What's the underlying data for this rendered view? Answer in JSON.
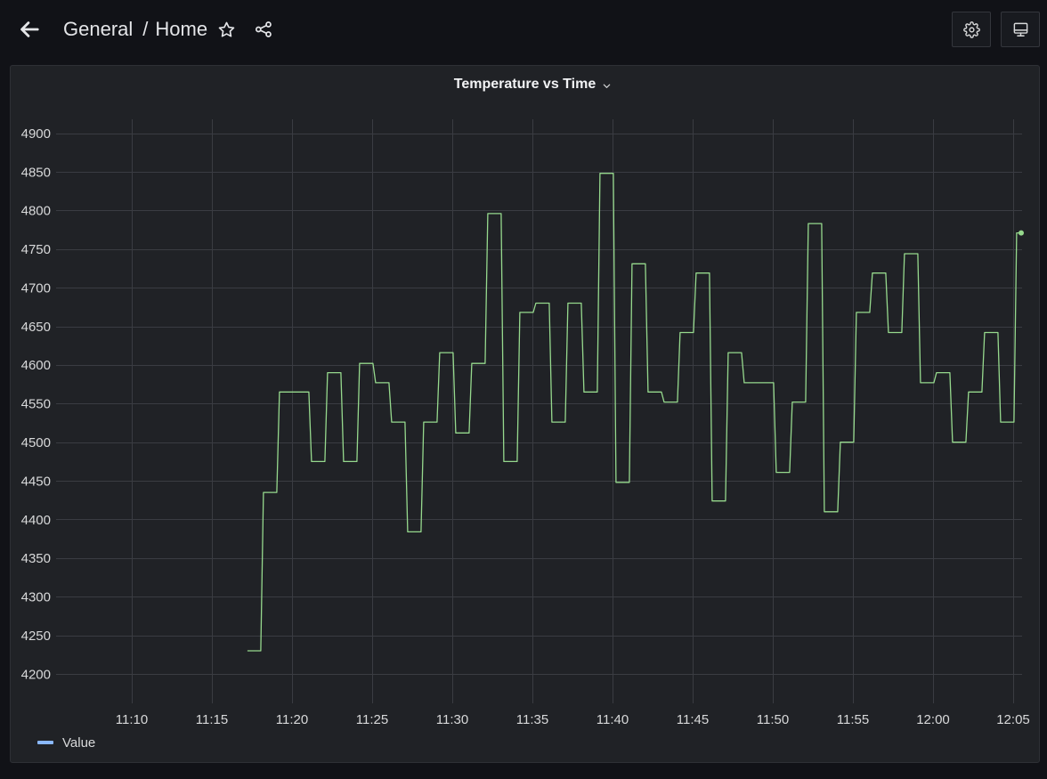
{
  "header": {
    "back_icon": "arrow-left-icon",
    "breadcrumb": {
      "folder": "General",
      "separator": "/",
      "dashboard": "Home"
    },
    "star_icon": "star-icon",
    "share_icon": "share-icon",
    "settings_icon": "gear-icon",
    "view_mode_icon": "monitor-icon"
  },
  "panel": {
    "menu_icon": "chevron-down-icon",
    "legend_swatch_color": "#8ab8ff"
  },
  "colors": {
    "page_background": "#111217",
    "panel_background": "#202226"
  },
  "chart_data": {
    "type": "line",
    "title": "Temperature vs Time",
    "x": [
      "11:17:13",
      "11:18:03",
      "11:18:13",
      "11:19:03",
      "11:19:13",
      "11:21:03",
      "11:21:13",
      "11:22:03",
      "11:22:13",
      "11:23:03",
      "11:23:13",
      "11:24:03",
      "11:24:13",
      "11:25:03",
      "11:25:13",
      "11:26:03",
      "11:26:13",
      "11:27:03",
      "11:27:13",
      "11:28:03",
      "11:28:13",
      "11:29:03",
      "11:29:13",
      "11:30:03",
      "11:30:13",
      "11:31:03",
      "11:31:13",
      "11:32:03",
      "11:32:13",
      "11:33:03",
      "11:33:13",
      "11:34:03",
      "11:34:13",
      "11:35:03",
      "11:35:13",
      "11:36:03",
      "11:36:13",
      "11:37:03",
      "11:37:13",
      "11:38:03",
      "11:38:13",
      "11:39:03",
      "11:39:13",
      "11:40:03",
      "11:40:13",
      "11:41:03",
      "11:41:13",
      "11:42:03",
      "11:42:13",
      "11:43:03",
      "11:43:13",
      "11:44:03",
      "11:44:13",
      "11:45:03",
      "11:45:13",
      "11:46:03",
      "11:46:13",
      "11:47:03",
      "11:47:13",
      "11:48:03",
      "11:48:13",
      "11:50:03",
      "11:50:13",
      "11:51:03",
      "11:51:13",
      "11:52:03",
      "11:52:13",
      "11:53:03",
      "11:53:13",
      "11:54:03",
      "11:54:13",
      "11:55:03",
      "11:55:13",
      "11:56:03",
      "11:56:13",
      "11:57:03",
      "11:57:13",
      "11:58:03",
      "11:58:13",
      "11:59:03",
      "11:59:13",
      "12:00:03",
      "12:00:13",
      "12:01:03",
      "12:01:13",
      "12:02:03",
      "12:02:13",
      "12:03:03",
      "12:03:13",
      "12:04:03",
      "12:04:13",
      "12:05:03",
      "12:05:13",
      "12:05:30"
    ],
    "series": [
      {
        "name": "Value",
        "color": "#96d98d",
        "values": [
          4230,
          4230,
          4435,
          4435,
          4565,
          4565,
          4475,
          4475,
          4590,
          4590,
          4475,
          4475,
          4602,
          4602,
          4577,
          4577,
          4526,
          4526,
          4384,
          4384,
          4526,
          4526,
          4616,
          4616,
          4512,
          4512,
          4602,
          4602,
          4796,
          4796,
          4475,
          4475,
          4668,
          4668,
          4680,
          4680,
          4526,
          4526,
          4680,
          4680,
          4565,
          4565,
          4848,
          4848,
          4448,
          4448,
          4731,
          4731,
          4565,
          4565,
          4552,
          4552,
          4642,
          4642,
          4719,
          4719,
          4424,
          4424,
          4616,
          4616,
          4577,
          4577,
          4461,
          4461,
          4552,
          4552,
          4783,
          4783,
          4410,
          4410,
          4500,
          4500,
          4668,
          4668,
          4719,
          4719,
          4642,
          4642,
          4744,
          4744,
          4577,
          4577,
          4590,
          4590,
          4500,
          4500,
          4565,
          4565,
          4642,
          4642,
          4526,
          4526,
          4771,
          4771
        ]
      }
    ],
    "xlim": [
      "11:05:30",
      "12:05:30"
    ],
    "ylim": [
      4162,
      4918
    ],
    "xticks": [
      "11:10",
      "11:15",
      "11:20",
      "11:25",
      "11:30",
      "11:35",
      "11:40",
      "11:45",
      "11:50",
      "11:55",
      "12:00",
      "12:05"
    ],
    "yticks": [
      4200,
      4250,
      4300,
      4350,
      4400,
      4450,
      4500,
      4550,
      4600,
      4650,
      4700,
      4750,
      4800,
      4850,
      4900
    ],
    "grid": true,
    "legend": "bottom-left"
  }
}
